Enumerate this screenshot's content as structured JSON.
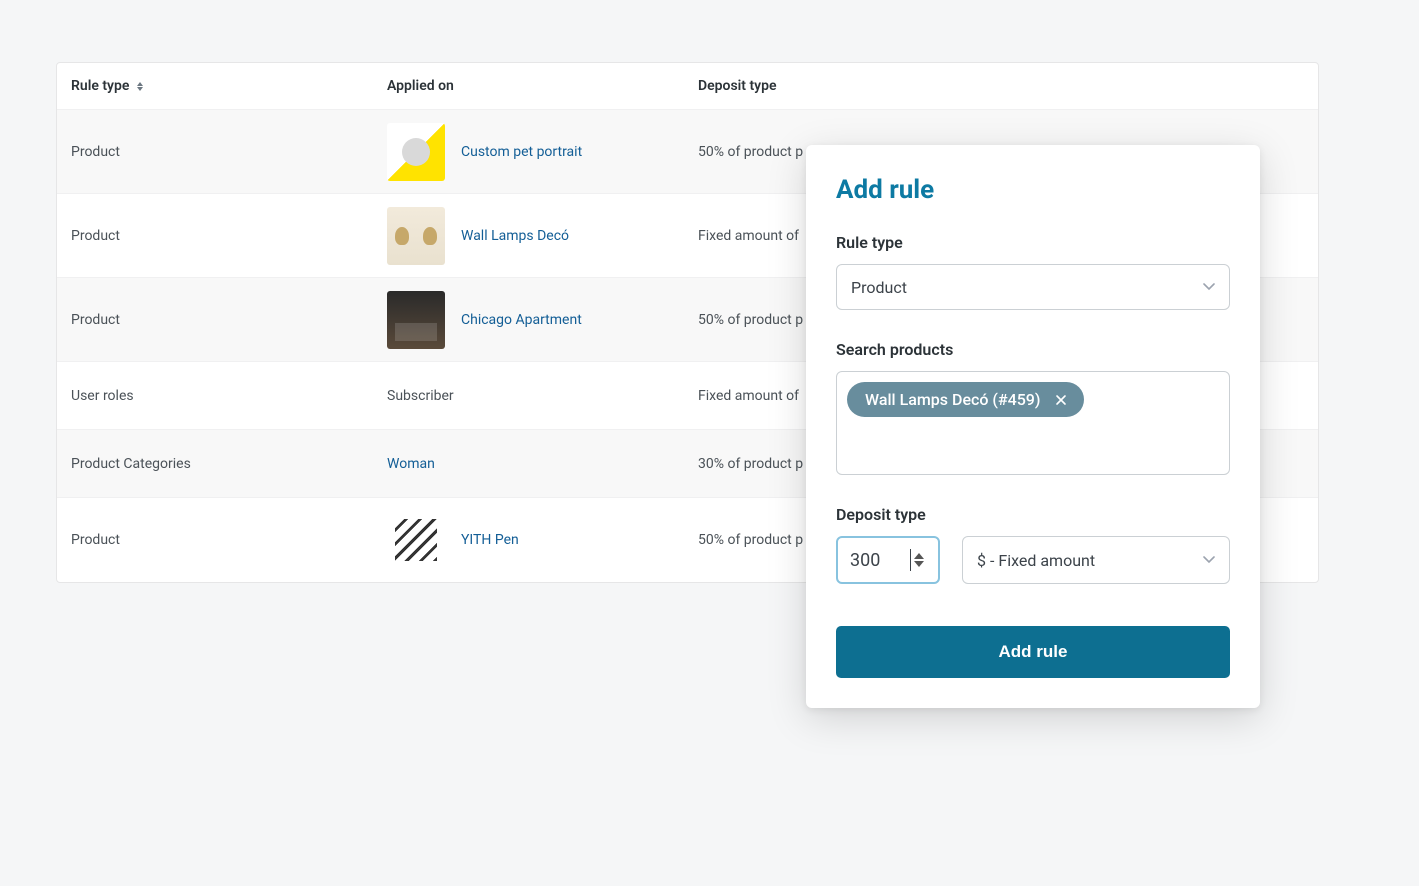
{
  "table": {
    "headers": {
      "rule_type": "Rule type",
      "applied_on": "Applied on",
      "deposit_type": "Deposit type"
    },
    "rows": [
      {
        "rule_type": "Product",
        "applied_label": "Custom pet portrait",
        "deposit": "50% of product p",
        "thumb_class": "thumb1",
        "is_link": true
      },
      {
        "rule_type": "Product",
        "applied_label": "Wall Lamps Decó",
        "deposit": "Fixed amount of",
        "thumb_class": "thumb2",
        "is_link": true
      },
      {
        "rule_type": "Product",
        "applied_label": "Chicago Apartment",
        "deposit": "50% of product p",
        "thumb_class": "thumb3",
        "is_link": true
      },
      {
        "rule_type": "User roles",
        "applied_label": "Subscriber",
        "deposit": "Fixed amount of",
        "thumb_class": "",
        "is_link": false,
        "no_thumb": true
      },
      {
        "rule_type": "Product Categories",
        "applied_label": "Woman",
        "deposit": "30% of product p",
        "thumb_class": "",
        "is_link": true,
        "no_thumb": true
      },
      {
        "rule_type": "Product",
        "applied_label": "YITH Pen",
        "deposit": "50% of product p",
        "thumb_class": "thumb4",
        "is_link": true
      }
    ]
  },
  "modal": {
    "title": "Add rule",
    "rule_type_label": "Rule type",
    "rule_type_value": "Product",
    "search_label": "Search products",
    "tag": "Wall Lamps Decó (#459)",
    "deposit_label": "Deposit type",
    "amount_value": "300",
    "unit_value": "$ - Fixed amount",
    "add_button": "Add rule"
  }
}
